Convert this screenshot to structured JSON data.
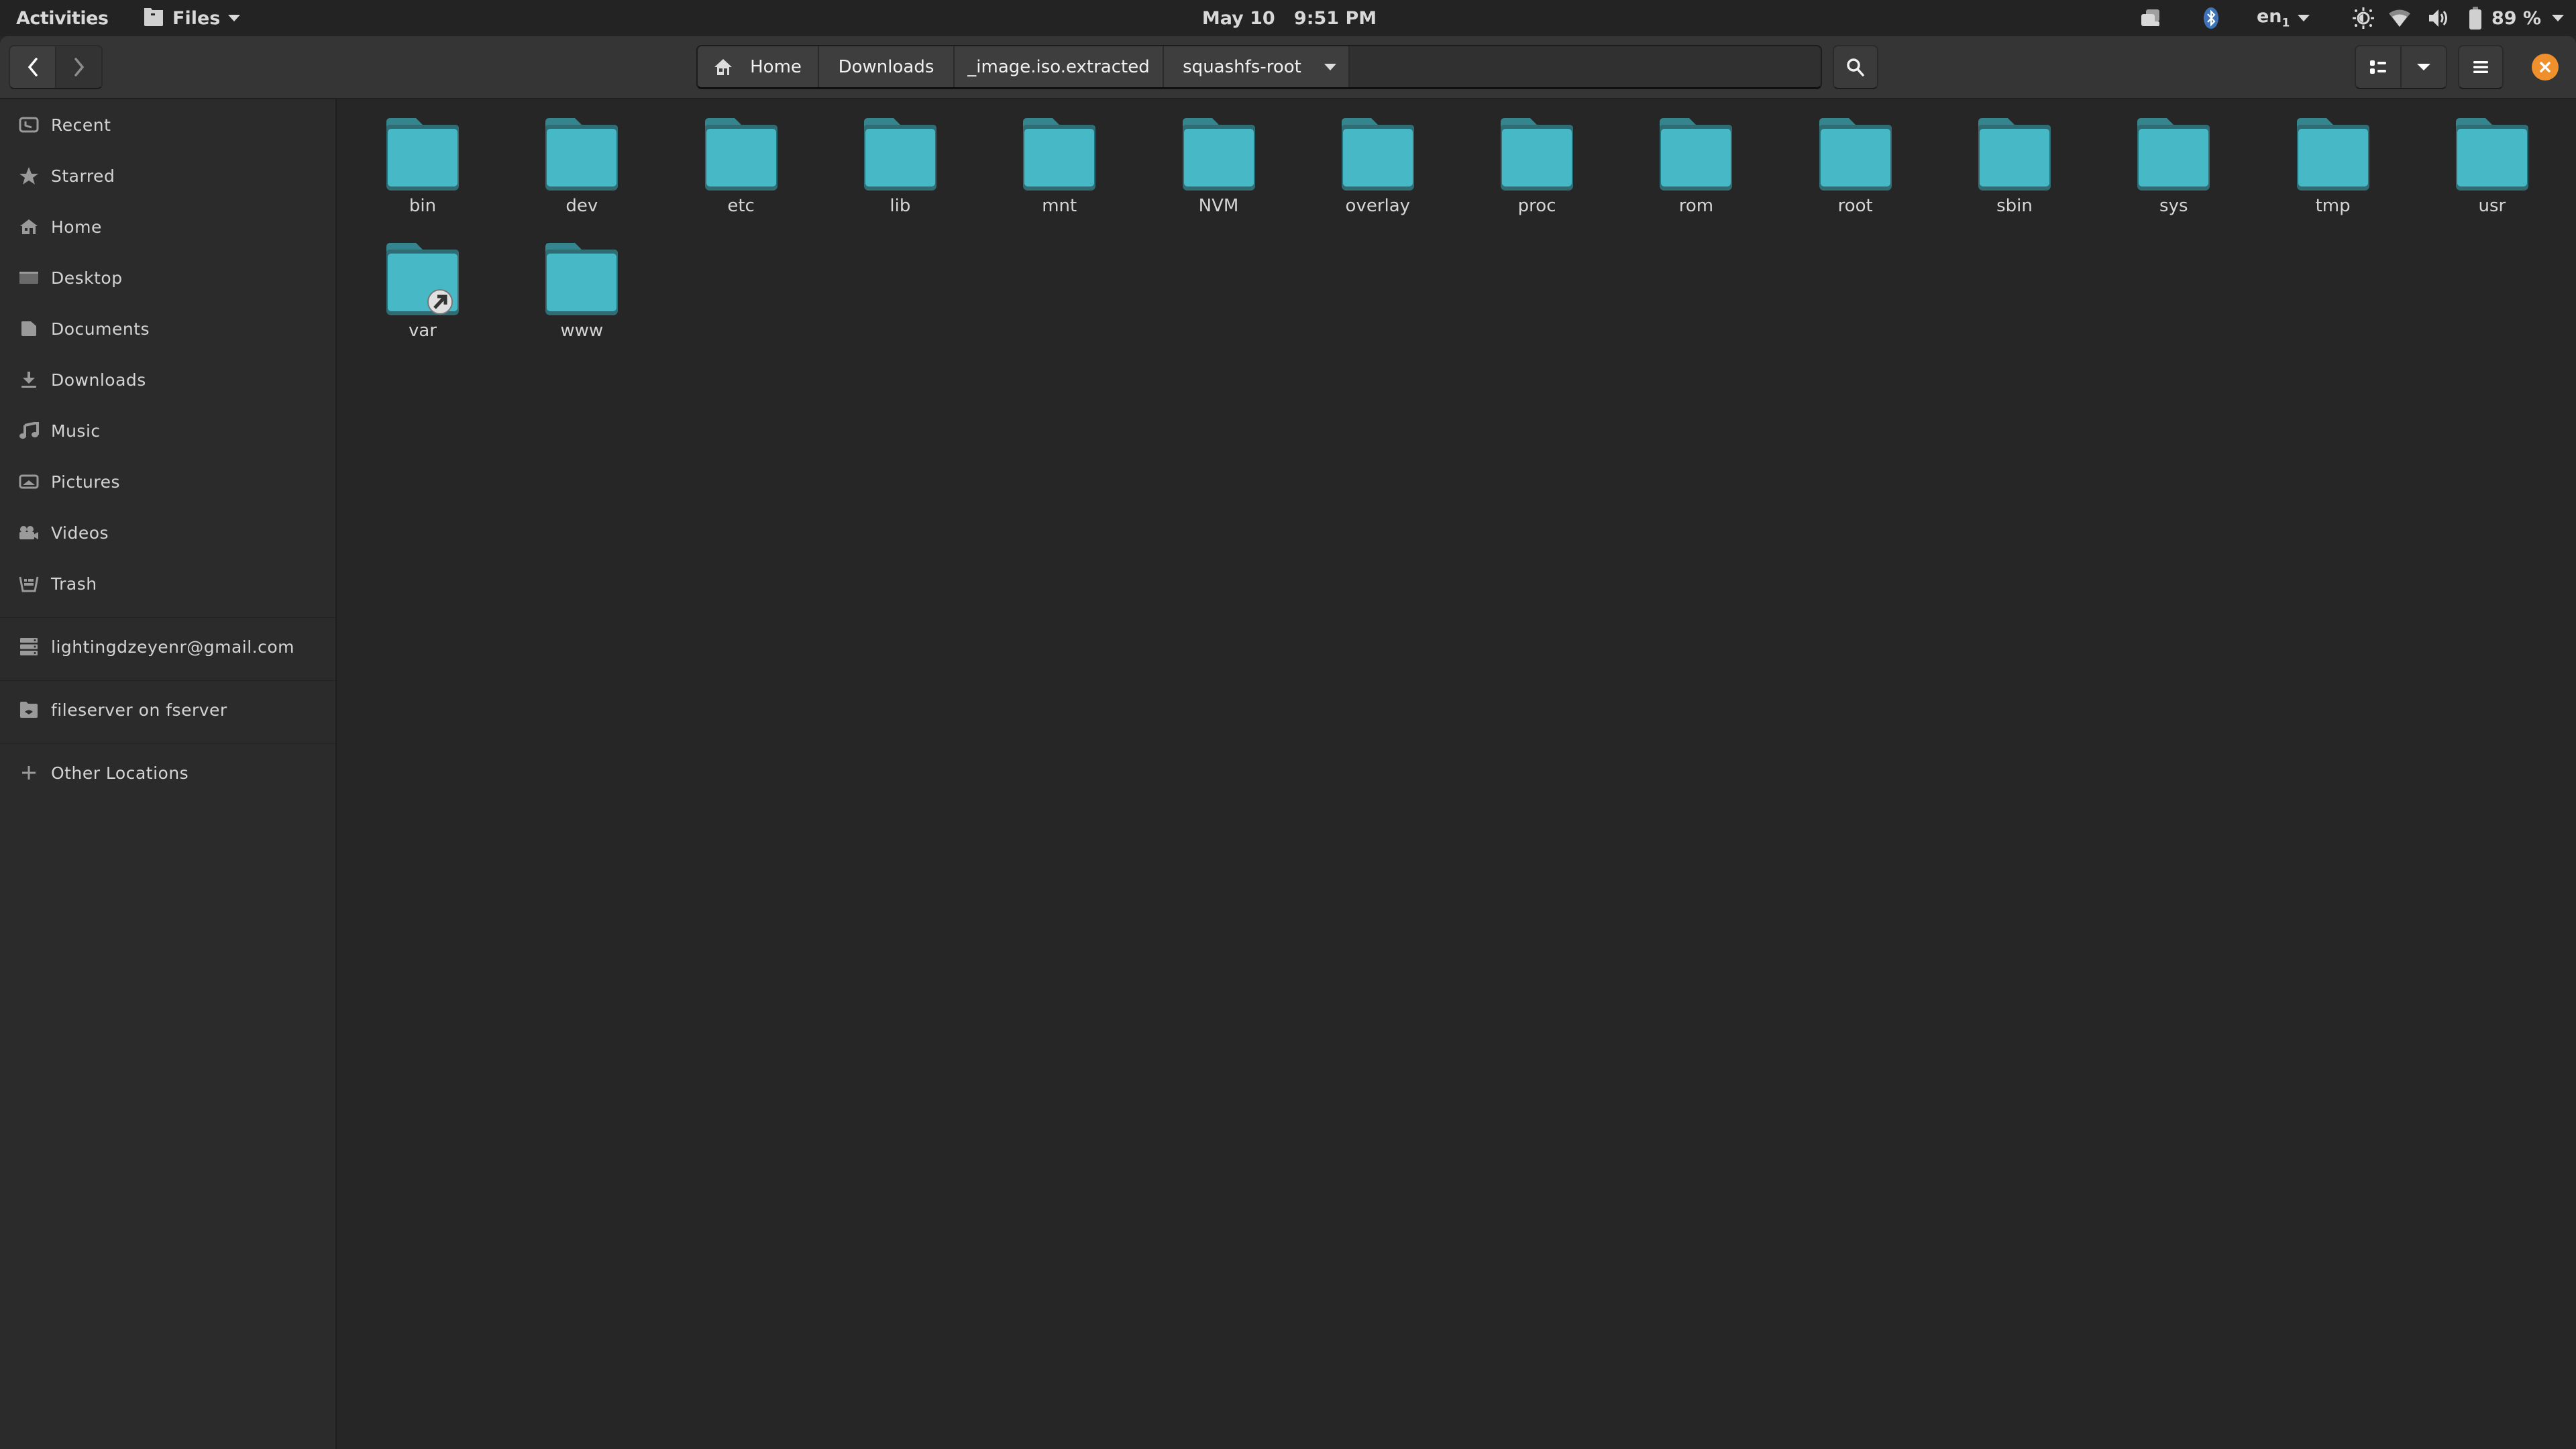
{
  "topbar": {
    "activities": "Activities",
    "app_name": "Files",
    "clock": "May 10   9:51 PM",
    "keyboard_layout": "en",
    "keyboard_layout_sub": "1",
    "battery": "89 %",
    "icons": [
      "window-switcher-icon",
      "bluetooth-icon",
      "brightness-icon",
      "wifi-icon",
      "volume-icon",
      "battery-icon"
    ]
  },
  "headerbar": {
    "back_icon": "chevron-left-icon",
    "forward_icon": "chevron-right-icon",
    "path": [
      {
        "label": "Home",
        "icon": "home-icon"
      },
      {
        "label": "Downloads"
      },
      {
        "label": "_image.iso.extracted"
      },
      {
        "label": "squashfs-root",
        "current": true
      }
    ],
    "search_icon": "search-icon",
    "view_icon": "list-view-icon",
    "view_options_icon": "chevron-down-icon",
    "menu_icon": "hamburger-menu-icon",
    "close_icon": "close-icon",
    "close_color": "#f0902c"
  },
  "sidebar": {
    "places": [
      {
        "label": "Recent",
        "icon": "clock-icon"
      },
      {
        "label": "Starred",
        "icon": "star-icon"
      },
      {
        "label": "Home",
        "icon": "home-icon"
      },
      {
        "label": "Desktop",
        "icon": "desktop-icon"
      },
      {
        "label": "Documents",
        "icon": "document-icon"
      },
      {
        "label": "Downloads",
        "icon": "download-icon"
      },
      {
        "label": "Music",
        "icon": "music-icon"
      },
      {
        "label": "Pictures",
        "icon": "picture-icon"
      },
      {
        "label": "Videos",
        "icon": "video-icon"
      },
      {
        "label": "Trash",
        "icon": "trash-icon"
      }
    ],
    "accounts": [
      {
        "label": "lightingdzeyenr@gmail.com",
        "icon": "server-icon"
      }
    ],
    "network": [
      {
        "label": "fileserver on fserver",
        "icon": "network-folder-icon"
      }
    ],
    "other": {
      "label": "Other Locations",
      "icon": "plus-icon"
    }
  },
  "content": {
    "folder_color": "#47b8c6",
    "items": [
      {
        "name": "bin"
      },
      {
        "name": "dev"
      },
      {
        "name": "etc"
      },
      {
        "name": "lib"
      },
      {
        "name": "mnt"
      },
      {
        "name": "NVM"
      },
      {
        "name": "overlay"
      },
      {
        "name": "proc"
      },
      {
        "name": "rom"
      },
      {
        "name": "root"
      },
      {
        "name": "sbin"
      },
      {
        "name": "sys"
      },
      {
        "name": "tmp"
      },
      {
        "name": "usr"
      },
      {
        "name": "var",
        "symlink": true
      },
      {
        "name": "www"
      }
    ]
  }
}
